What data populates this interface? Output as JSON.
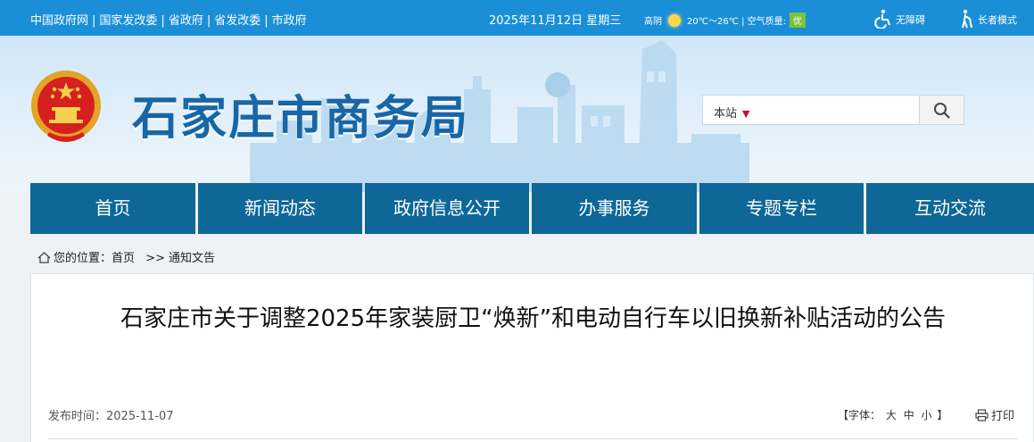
{
  "topbar": {
    "links": [
      "中国政府网",
      "国家发改委",
      "省政府",
      "省发改委",
      "市政府"
    ],
    "separator": "|",
    "date": "2025年11月12日 星期三",
    "weather": {
      "condition": "高阴",
      "icon": "sun-icon",
      "temperature": "20℃～26℃",
      "divider": "|",
      "air_quality_label": "空气质量:",
      "air_quality_value": "优"
    },
    "accessibility_label": "无障碍",
    "elderly_mode_label": "长者模式"
  },
  "banner": {
    "site_title": "石家庄市商务局",
    "emblem": "national-emblem"
  },
  "search": {
    "scope": "本站",
    "placeholder": "",
    "button_icon": "search-icon"
  },
  "nav": {
    "items": [
      "首页",
      "新闻动态",
      "政府信息公开",
      "办事服务",
      "专题专栏",
      "互动交流"
    ]
  },
  "breadcrumb": {
    "prefix": "您的位置：",
    "home": "首页",
    "separator": ">>",
    "current": "通知文告"
  },
  "article": {
    "title": "石家庄市关于调整2025年家装厨卫“焕新”和电动自行车以旧换新补贴活动的公告",
    "publish_label": "发布时间：",
    "publish_date": "2025-11-07",
    "font_size": {
      "open": "【字体：",
      "large": "大",
      "medium": "中",
      "small": "小",
      "close": "】"
    },
    "print_label": "打印"
  },
  "colors": {
    "topbar": "#1a8fd8",
    "nav": "#0e6797",
    "title": "#1866a6",
    "aqi_good": "#7ec13c"
  }
}
